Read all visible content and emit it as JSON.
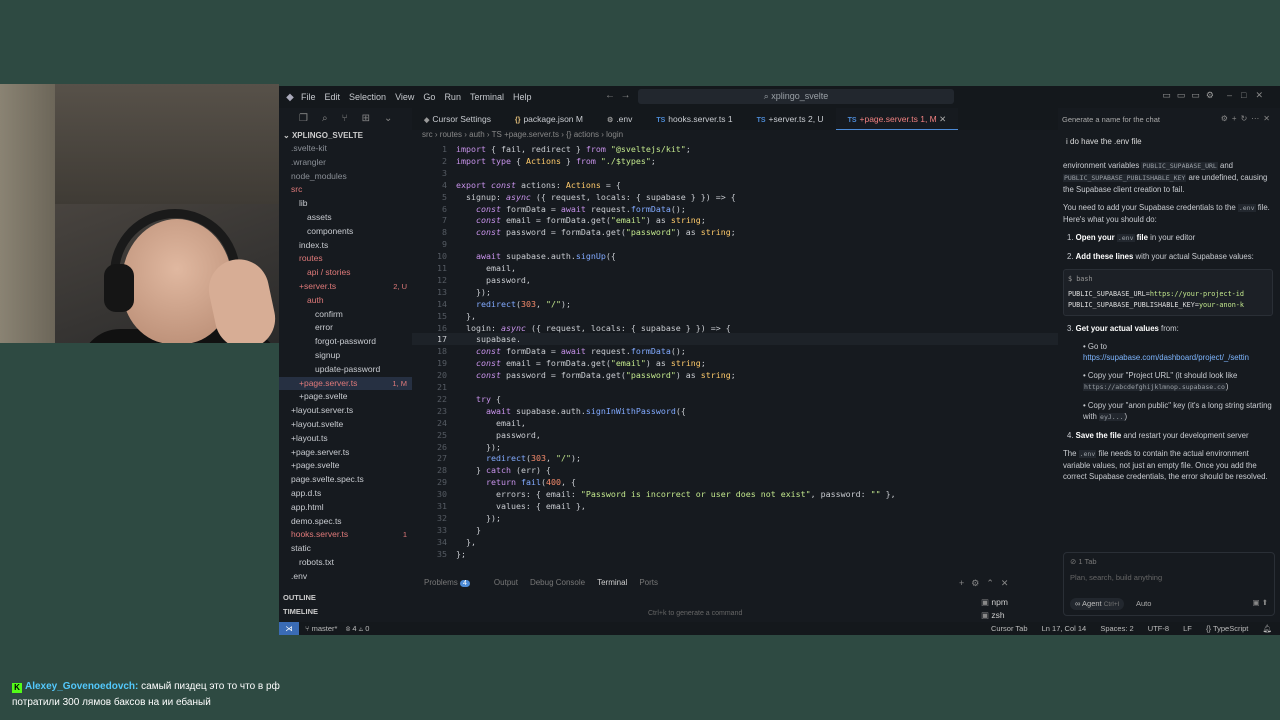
{
  "stream_chat": {
    "username": "Alexey_Govenoedovch:",
    "message": "самый пиздец это то что в рф потратили 300 лямов баксов на ии ебаный"
  },
  "ide": {
    "menu": [
      "File",
      "Edit",
      "Selection",
      "View",
      "Go",
      "Run",
      "Terminal",
      "Help"
    ],
    "search_text": "xplingo_svelte",
    "tabs": [
      {
        "label": "Cursor Settings",
        "icon": "cursor-icon"
      },
      {
        "label": "package.json M",
        "icon": "json-icon"
      },
      {
        "label": ".env",
        "icon": "gear-icon"
      },
      {
        "label": "hooks.server.ts 1",
        "icon": "ts-icon"
      },
      {
        "label": "+server.ts 2, U",
        "icon": "ts-icon"
      },
      {
        "label": "+page.server.ts 1, M",
        "icon": "ts-icon",
        "active": true
      }
    ],
    "breadcrumb": "src › routes › auth › TS +page.server.ts › {} actions › login",
    "explorer_root": "XPLINGO_SVELTE",
    "tree": [
      {
        "label": ".svelte-kit",
        "color": "#8a8f96"
      },
      {
        "label": ".wrangler",
        "color": "#8a8f96"
      },
      {
        "label": "node_modules",
        "color": "#8a8f96"
      },
      {
        "label": "src",
        "color": "#e07a7a"
      },
      {
        "label": "lib",
        "color": "#c9ccd1"
      },
      {
        "label": "assets",
        "color": "#c9ccd1"
      },
      {
        "label": "components",
        "color": "#c9ccd1"
      },
      {
        "label": "index.ts",
        "color": "#c9ccd1"
      },
      {
        "label": "routes",
        "color": "#e07a7a"
      },
      {
        "label": "api / stories",
        "color": "#e07a7a"
      },
      {
        "label": "+server.ts",
        "color": "#e07a7a",
        "badge": "2, U"
      },
      {
        "label": "auth",
        "color": "#e07a7a"
      },
      {
        "label": "confirm",
        "color": "#c9ccd1"
      },
      {
        "label": "error",
        "color": "#c9ccd1"
      },
      {
        "label": "forgot-password",
        "color": "#c9ccd1"
      },
      {
        "label": "signup",
        "color": "#c9ccd1"
      },
      {
        "label": "update-password",
        "color": "#c9ccd1"
      },
      {
        "label": "+page.server.ts",
        "color": "#e07a7a",
        "badge": "1, M"
      },
      {
        "label": "+page.svelte",
        "color": "#c9ccd1"
      },
      {
        "label": "+layout.server.ts",
        "color": "#c9ccd1"
      },
      {
        "label": "+layout.svelte",
        "color": "#c9ccd1"
      },
      {
        "label": "+layout.ts",
        "color": "#c9ccd1"
      },
      {
        "label": "+page.server.ts",
        "color": "#c9ccd1"
      },
      {
        "label": "+page.svelte",
        "color": "#c9ccd1"
      },
      {
        "label": "page.svelte.spec.ts",
        "color": "#c9ccd1"
      },
      {
        "label": "app.d.ts",
        "color": "#c9ccd1"
      },
      {
        "label": "app.html",
        "color": "#c9ccd1"
      },
      {
        "label": "demo.spec.ts",
        "color": "#c9ccd1"
      },
      {
        "label": "hooks.server.ts",
        "color": "#e07a7a",
        "badge": "1"
      },
      {
        "label": "static",
        "color": "#c9ccd1"
      },
      {
        "label": "robots.txt",
        "color": "#c9ccd1"
      },
      {
        "label": ".env",
        "color": "#c9ccd1"
      }
    ],
    "outline_label": "OUTLINE",
    "timeline_label": "TIMELINE",
    "code_lines": [
      "import { fail, redirect } from \"@sveltejs/kit\";",
      "import type { Actions } from \"./$types\";",
      "",
      "export const actions: Actions = {",
      "  signup: async ({ request, locals: { supabase } }) => {",
      "    const formData = await request.formData();",
      "    const email = formData.get(\"email\") as string;",
      "    const password = formData.get(\"password\") as string;",
      "",
      "    await supabase.auth.signUp({",
      "      email,",
      "      password,",
      "    });",
      "    redirect(303, \"/\");",
      "  },",
      "  login: async ({ request, locals: { supabase } }) => {",
      "    supabase.",
      "    const formData = await request.formData();",
      "    const email = formData.get(\"email\") as string;",
      "    const password = formData.get(\"password\") as string;",
      "",
      "    try {",
      "      await supabase.auth.signInWithPassword({",
      "        email,",
      "        password,",
      "      });",
      "      redirect(303, \"/\");",
      "    } catch (err) {",
      "      return fail(400, {",
      "        errors: { email: \"Password is incorrect or user does not exist\", password: \"\" },",
      "        values: { email },",
      "      });",
      "    }",
      "  },",
      "};"
    ],
    "current_line": 17,
    "panel_tabs": [
      "Problems",
      "Output",
      "Debug Console",
      "Terminal",
      "Ports"
    ],
    "problems_count": "4",
    "terminal_hint": "Ctrl+k to generate a command",
    "terminals": [
      "npm",
      "zsh"
    ],
    "status": {
      "branch": "master*",
      "errors": "⊗ 4 ⚠ 0",
      "cursor_tab": "Cursor Tab",
      "position": "Ln 17, Col 14",
      "spaces": "Spaces: 2",
      "encoding": "UTF-8",
      "eol": "LF",
      "language": "{} TypeScript"
    },
    "chat": {
      "header": "Generate a name for the chat",
      "question": "i do have the .env file",
      "p1_a": "environment variables",
      "p1_code1": "PUBLIC_SUPABASE_URL",
      "p1_b": "and",
      "p1_code2": "PUBLIC_SUPABASE_PUBLISHABLE_KEY",
      "p1_c": "are undefined, causing the Supabase client creation to fail.",
      "p2_a": "You need to add your Supabase credentials to the",
      "p2_code": ".env",
      "p2_b": "file. Here's what you should do:",
      "step1_b": "Open your",
      "step1_code": ".env",
      "step1_b2": "file",
      "step1_rest": "in your editor",
      "step2_b": "Add these lines",
      "step2_rest": "with your actual Supabase values:",
      "code_lang": "bash",
      "code_line1_key": "PUBLIC_SUPABASE_URL=",
      "code_line1_val": "https://your-project-id",
      "code_line2_key": "PUBLIC_SUPABASE_PUBLISHABLE_KEY=",
      "code_line2_val": "your-anon-k",
      "step3_b": "Get your actual values",
      "step3_rest": "from:",
      "sub1_a": "Go to",
      "sub1_link": "https://supabase.com/dashboard/project/_/settin",
      "sub2_a": "Copy your \"Project URL\" (it should look like",
      "sub2_code": "https://abcdefghijklmnop.supabase.co",
      "sub2_b": ")",
      "sub3_a": "Copy your \"anon public\" key (it's a long string starting with",
      "sub3_code": "eyJ...",
      "sub3_b": ")",
      "step4_b": "Save the file",
      "step4_rest": "and restart your development server",
      "p3_a": "The",
      "p3_code": ".env",
      "p3_b": "file needs to contain the actual environment variable values, not just an empty file. Once you add the correct Supabase credentials, the error should be resolved.",
      "tab_count": "1 Tab",
      "input_placeholder": "Plan, search, build anything",
      "agent_label": "∞ Agent",
      "agent_shortcut": "Ctrl+I",
      "model": "Auto"
    }
  }
}
